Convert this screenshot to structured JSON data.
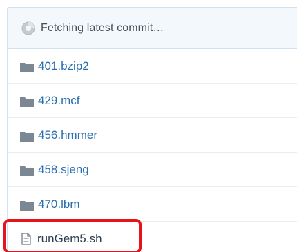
{
  "commit_bar": {
    "status_text": "Fetching latest commit…",
    "icon": "spinner-icon"
  },
  "entries": [
    {
      "name": "401.bzip2",
      "type": "directory",
      "icon": "folder-icon"
    },
    {
      "name": "429.mcf",
      "type": "directory",
      "icon": "folder-icon"
    },
    {
      "name": "456.hmmer",
      "type": "directory",
      "icon": "folder-icon"
    },
    {
      "name": "458.sjeng",
      "type": "directory",
      "icon": "folder-icon"
    },
    {
      "name": "470.lbm",
      "type": "directory",
      "icon": "folder-icon"
    },
    {
      "name": "runGem5.sh",
      "type": "file",
      "icon": "file-icon",
      "highlighted": true
    }
  ],
  "colors": {
    "link": "#2a6fb0",
    "folder": "#7b8793",
    "header_bg": "#f2f8fc",
    "highlight": "#e8131a"
  }
}
